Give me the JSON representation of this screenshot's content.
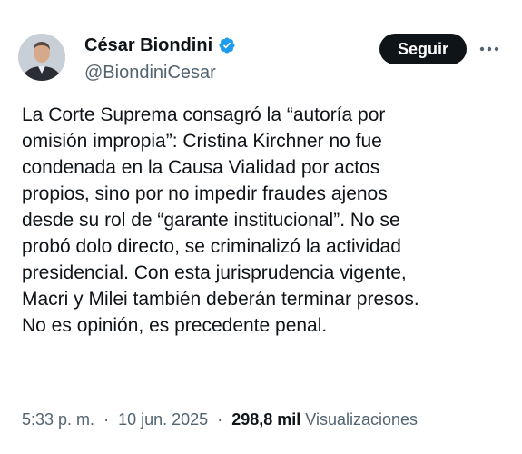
{
  "author": {
    "display_name": "César Biondini",
    "handle": "@BiondiniCesar",
    "verified": true,
    "verified_color": "#1d9bf0"
  },
  "actions": {
    "follow_label": "Seguir",
    "more_icon": "more-horizontal-icon"
  },
  "tweet": {
    "lines": [
      "La Corte Suprema consagró la “autoría por",
      "omisión impropia”: Cristina Kirchner no fue",
      "condenada en la Causa Vialidad por actos",
      "propios, sino por no impedir fraudes ajenos",
      "desde su rol de “garante institucional”. No se",
      "probó dolo directo, se criminalizó la actividad",
      "presidencial. Con esta jurisprudencia vigente,",
      "Macri y Milei también deberán terminar presos.",
      "No es opinión, es precedente penal."
    ]
  },
  "meta": {
    "time": "5:33 p. m.",
    "separator": "·",
    "date": "10 jun. 2025",
    "views_count": "298,8 mil",
    "views_label": "Visualizaciones"
  },
  "colors": {
    "text_primary": "#0f1419",
    "text_secondary": "#536471",
    "button_bg": "#0f1419"
  }
}
